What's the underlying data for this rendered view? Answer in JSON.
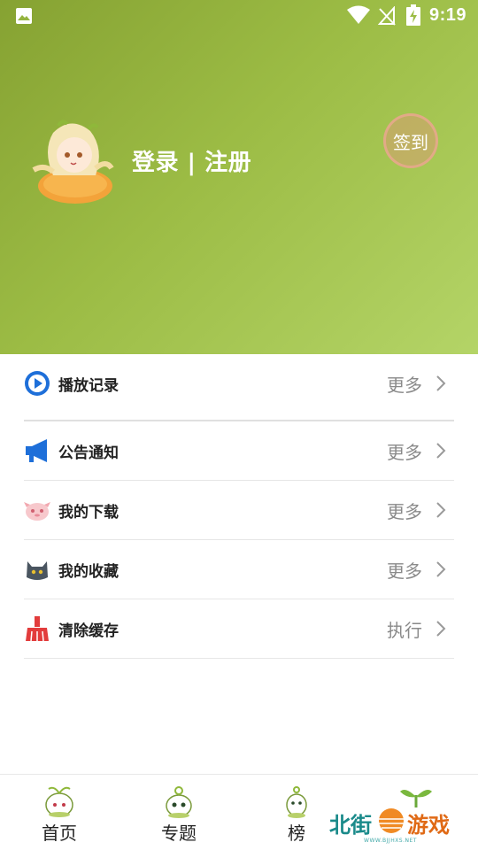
{
  "status_bar": {
    "time": "9:19"
  },
  "header": {
    "login_register": "登录 | 注册",
    "checkin_label": "签到"
  },
  "menu": {
    "items": [
      {
        "label": "播放记录",
        "action": "更多",
        "icon": "play-circle-icon",
        "icon_color": "#1e6fd9"
      },
      {
        "label": "公告通知",
        "action": "更多",
        "icon": "megaphone-icon",
        "icon_color": "#1e6fd9"
      },
      {
        "label": "我的下载",
        "action": "更多",
        "icon": "pink-creature-icon",
        "icon_color": "#f2a8b0"
      },
      {
        "label": "我的收藏",
        "action": "更多",
        "icon": "cat-icon",
        "icon_color": "#4a5560"
      },
      {
        "label": "清除缓存",
        "action": "执行",
        "icon": "broom-icon",
        "icon_color": "#e23c3c"
      }
    ]
  },
  "tabs": [
    {
      "label": "首页",
      "icon": "sprout-mascot-icon"
    },
    {
      "label": "专题",
      "icon": "sprout-mascot-icon"
    },
    {
      "label": "榜",
      "icon": "sprout-mascot-icon"
    }
  ],
  "watermark": {
    "text_left": "北街",
    "text_right": "游戏",
    "url": "WWW.BJJHXS.NET"
  },
  "colors": {
    "header_start": "#86a232",
    "header_end": "#b4d467",
    "action_text": "#8a8a8a"
  }
}
